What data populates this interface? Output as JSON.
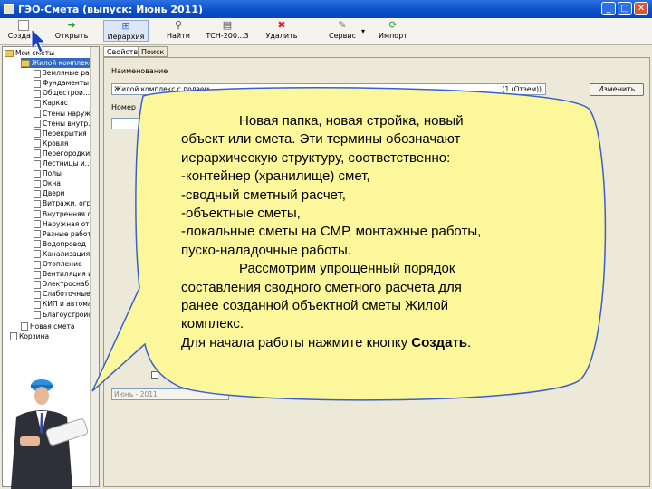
{
  "window": {
    "title": "ГЭО-Смета  (выпуск: Июнь 2011)",
    "btn_min": "_",
    "btn_max": "□",
    "btn_close": "✕"
  },
  "toolbar": {
    "items": [
      {
        "label": "Создать",
        "icon": "new-doc-icon"
      },
      {
        "label": "Открыть",
        "icon": "arrow-open-icon"
      },
      {
        "label": "Иерархия",
        "icon": "hierarchy-icon"
      },
      {
        "label": "Найти",
        "icon": "find-icon"
      },
      {
        "label": "ТСН-200...3",
        "icon": "tsn-icon"
      },
      {
        "label": "Удалить",
        "icon": "delete-icon"
      },
      {
        "label": "Сервис",
        "icon": "service-icon"
      },
      {
        "label": "Импорт",
        "icon": "import-icon"
      }
    ]
  },
  "tree": {
    "root_label": "Мои сметы",
    "items": [
      "Жилой комплекс",
      "Земляные работы",
      "Фундаменты и",
      "Общестрои...",
      "Каркас",
      "Стены наружн...",
      "Стены внутр...",
      "Перекрытия",
      "Кровля",
      "Перегородки",
      "Лестницы и...",
      "Полы",
      "Окна",
      "Двери",
      "Витражи, огр...",
      "Внутренняя о...",
      "Наружная от...",
      "Разные работ...",
      "Водопровод",
      "Канализация",
      "Отопление",
      "Вентиляция и...",
      "Электроснаб...",
      "Слаботочные...",
      "КИП и автома...",
      "Благоустройство"
    ],
    "new_label": "Новая смета",
    "trash_label": "Корзина"
  },
  "tabs": [
    "Свойства",
    "Поиск"
  ],
  "props": {
    "name_label": "Наименование",
    "name_value": "Жилой комплекс с подзем...",
    "name_suffix": "(1 (Отзем))",
    "change_button": "Изменить",
    "number_label": "Номер",
    "version_value": "Июнь - 2011"
  },
  "callout": {
    "para1": "Новая папка, новая стройка, новый",
    "para1_rest": [
      "объект или смета. Эти термины  обозначают",
      "иерархическую структуру, соответственно:",
      "-контейнер (хранилище) смет,",
      "-сводный сметный расчет,",
      "-объектные сметы,",
      "-локальные сметы на СМР, монтажные работы,",
      "пуско-наладочные работы."
    ],
    "para2": "Рассмотрим упрощенный порядок",
    "para2_rest": [
      "составления сводного сметного расчета для",
      "ранее созданной объектной сметы Жилой",
      "комплекс."
    ],
    "final_prefix": "Для начала работы нажмите кнопку ",
    "final_bold": "Создать",
    "final_suffix": "."
  },
  "colors": {
    "bubble_fill": "#fdf79c",
    "bubble_stroke": "#3b5fcc",
    "titlebar": "#0a4ecb"
  }
}
